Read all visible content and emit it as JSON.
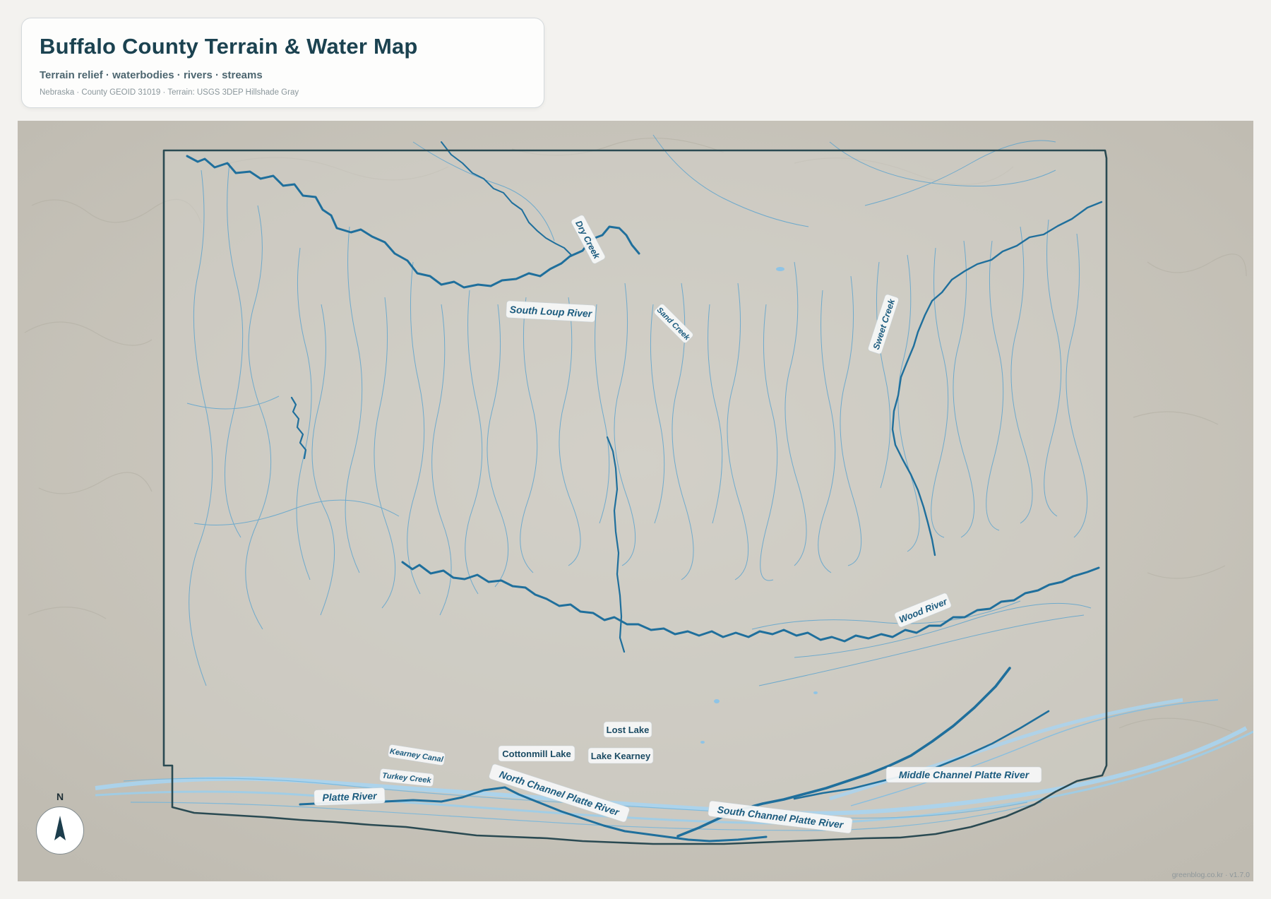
{
  "header": {
    "title": "Buffalo County Terrain & Water Map",
    "subtitle": "Terrain relief · waterbodies · rivers · streams",
    "meta": "Nebraska · County GEOID 31019 · Terrain: USGS 3DEP Hillshade Gray"
  },
  "map": {
    "river_labels": {
      "south_loup": "South Loup River",
      "dry_creek": "Dry Creek",
      "sand_creek": "Sand Creek",
      "sweet_creek": "Sweet Creek",
      "wood_river": "Wood River",
      "kearney_canal": "Kearney Canal",
      "turkey_creek": "Turkey Creek",
      "platte": "Platte River",
      "north_channel": "North Channel Platte River",
      "south_channel": "South Channel Platte River",
      "middle_channel": "Middle Channel Platte River"
    },
    "lake_labels": {
      "lost_lake": "Lost Lake",
      "cottonmill": "Cottonmill Lake",
      "lake_kearney": "Lake Kearney"
    },
    "colors": {
      "background": "#cbc8bf",
      "county_boundary": "#2a4a52",
      "river": "#1f6f9c",
      "stream": "#4f9fcf",
      "waterbody": "#a9d4ef"
    }
  },
  "compass": {
    "label": "N"
  },
  "footer": {
    "credit": "greenblog.co.kr · v1.7.0"
  }
}
